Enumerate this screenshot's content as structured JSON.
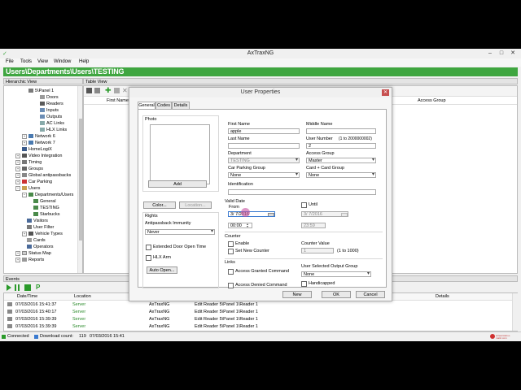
{
  "window": {
    "title": "AxTraxNG"
  },
  "menu": [
    "File",
    "Tools",
    "View",
    "Window",
    "Help"
  ],
  "path": "Users\\Departments\\Users\\TESTING",
  "hierarchic_view": {
    "title": "Hierarchic View",
    "items": [
      "5\\Panel 1",
      "Doors",
      "Readers",
      "Inputs",
      "Outputs",
      "AC Links",
      "HLX Links",
      "Network 6",
      "Network 7",
      "HomeLogiX",
      "Video Integration",
      "Timing",
      "Groups",
      "Global antipassbacks",
      "Car Parking",
      "Users",
      "Departments/Users",
      "General",
      "TESTING",
      "Starbucks",
      "Visitors",
      "User Filter",
      "Vehicle Types",
      "Cards",
      "Operators",
      "Status Map",
      "Reports"
    ]
  },
  "table_view": {
    "title": "Table View",
    "columns": [
      "First Name",
      "Access Group"
    ]
  },
  "dialog": {
    "title": "User Properties",
    "tabs": [
      "General",
      "Codes",
      "Details"
    ],
    "photo_label": "Photo",
    "add_button": "Add",
    "color_button": "Color...",
    "location_button": "Location...",
    "rights_label": "Rights",
    "antipassback_label": "Antipassback Immunity",
    "antipassback_value": "Never",
    "extended_door_label": "Extended Door Open Time",
    "hlx_label": "HLX Arm",
    "auto_open_button": "Auto Open...",
    "first_name_label": "First Name",
    "first_name_value": "apple",
    "middle_name_label": "Middle Name",
    "middle_name_value": "",
    "last_name_label": "Last Name",
    "last_name_value": "",
    "user_number_label": "User Number",
    "user_number_range": "(1 to 2000000002)",
    "user_number_value": "2",
    "department_label": "Department",
    "department_value": "TESTING",
    "access_group_label": "Access Group",
    "access_group_value": "Master",
    "car_parking_label": "Car Parking Group",
    "car_parking_value": "None",
    "card_group_label": "Card + Card Group",
    "card_group_value": "None",
    "identification_label": "Identification",
    "identification_value": "",
    "valid_date_label": "Valid Date",
    "from_label": "From",
    "from_date": "3/  7/2016",
    "from_time": "00:00",
    "until_label": "Until",
    "until_date": "3/  7/2016",
    "until_time": "23:59",
    "counter_label": "Counter",
    "enable_label": "Enable",
    "set_new_counter_label": "Set New Counter",
    "counter_value_label": "Counter Value",
    "counter_value": "1",
    "counter_range": "(1 to 1000)",
    "links_label": "Links",
    "access_granted_label": "Access Granted Command",
    "access_denied_label": "Access Denied Command",
    "output_group_label": "User Selected Output Group",
    "output_group_value": "None",
    "handicapped_label": "Handicapped",
    "new_button": "New",
    "ok_button": "OK",
    "cancel_button": "Cancel"
  },
  "events": {
    "title": "Events",
    "columns": [
      "Date/Time",
      "Location",
      "Details"
    ],
    "rows": [
      {
        "datetime": "07/03/2016 15:41:37",
        "location": "Server",
        "source": "AxTraxNG",
        "desc": "Edit Reader 5\\Panel 1\\Reader 1"
      },
      {
        "datetime": "07/03/2016 15:40:17",
        "location": "Server",
        "source": "AxTraxNG",
        "desc": "Edit Reader 5\\Panel 1\\Reader 1"
      },
      {
        "datetime": "07/03/2016 15:39:39",
        "location": "Server",
        "source": "AxTraxNG",
        "desc": "Edit Reader 5\\Panel 1\\Reader 1"
      },
      {
        "datetime": "07/03/2016 15:39:39",
        "location": "Server",
        "source": "AxTraxNG",
        "desc": "Edit Reader 5\\Panel 1\\Reader 1"
      }
    ]
  },
  "status": {
    "connected": "Connected",
    "download_label": "Download count:",
    "download_count": "119",
    "timestamp": "07/03/2016 15:41"
  },
  "watermark": "screencast-o-matic.com",
  "colors": {
    "accent": "#3fa640",
    "server": "#2a8a2a",
    "close": "#c75050"
  }
}
